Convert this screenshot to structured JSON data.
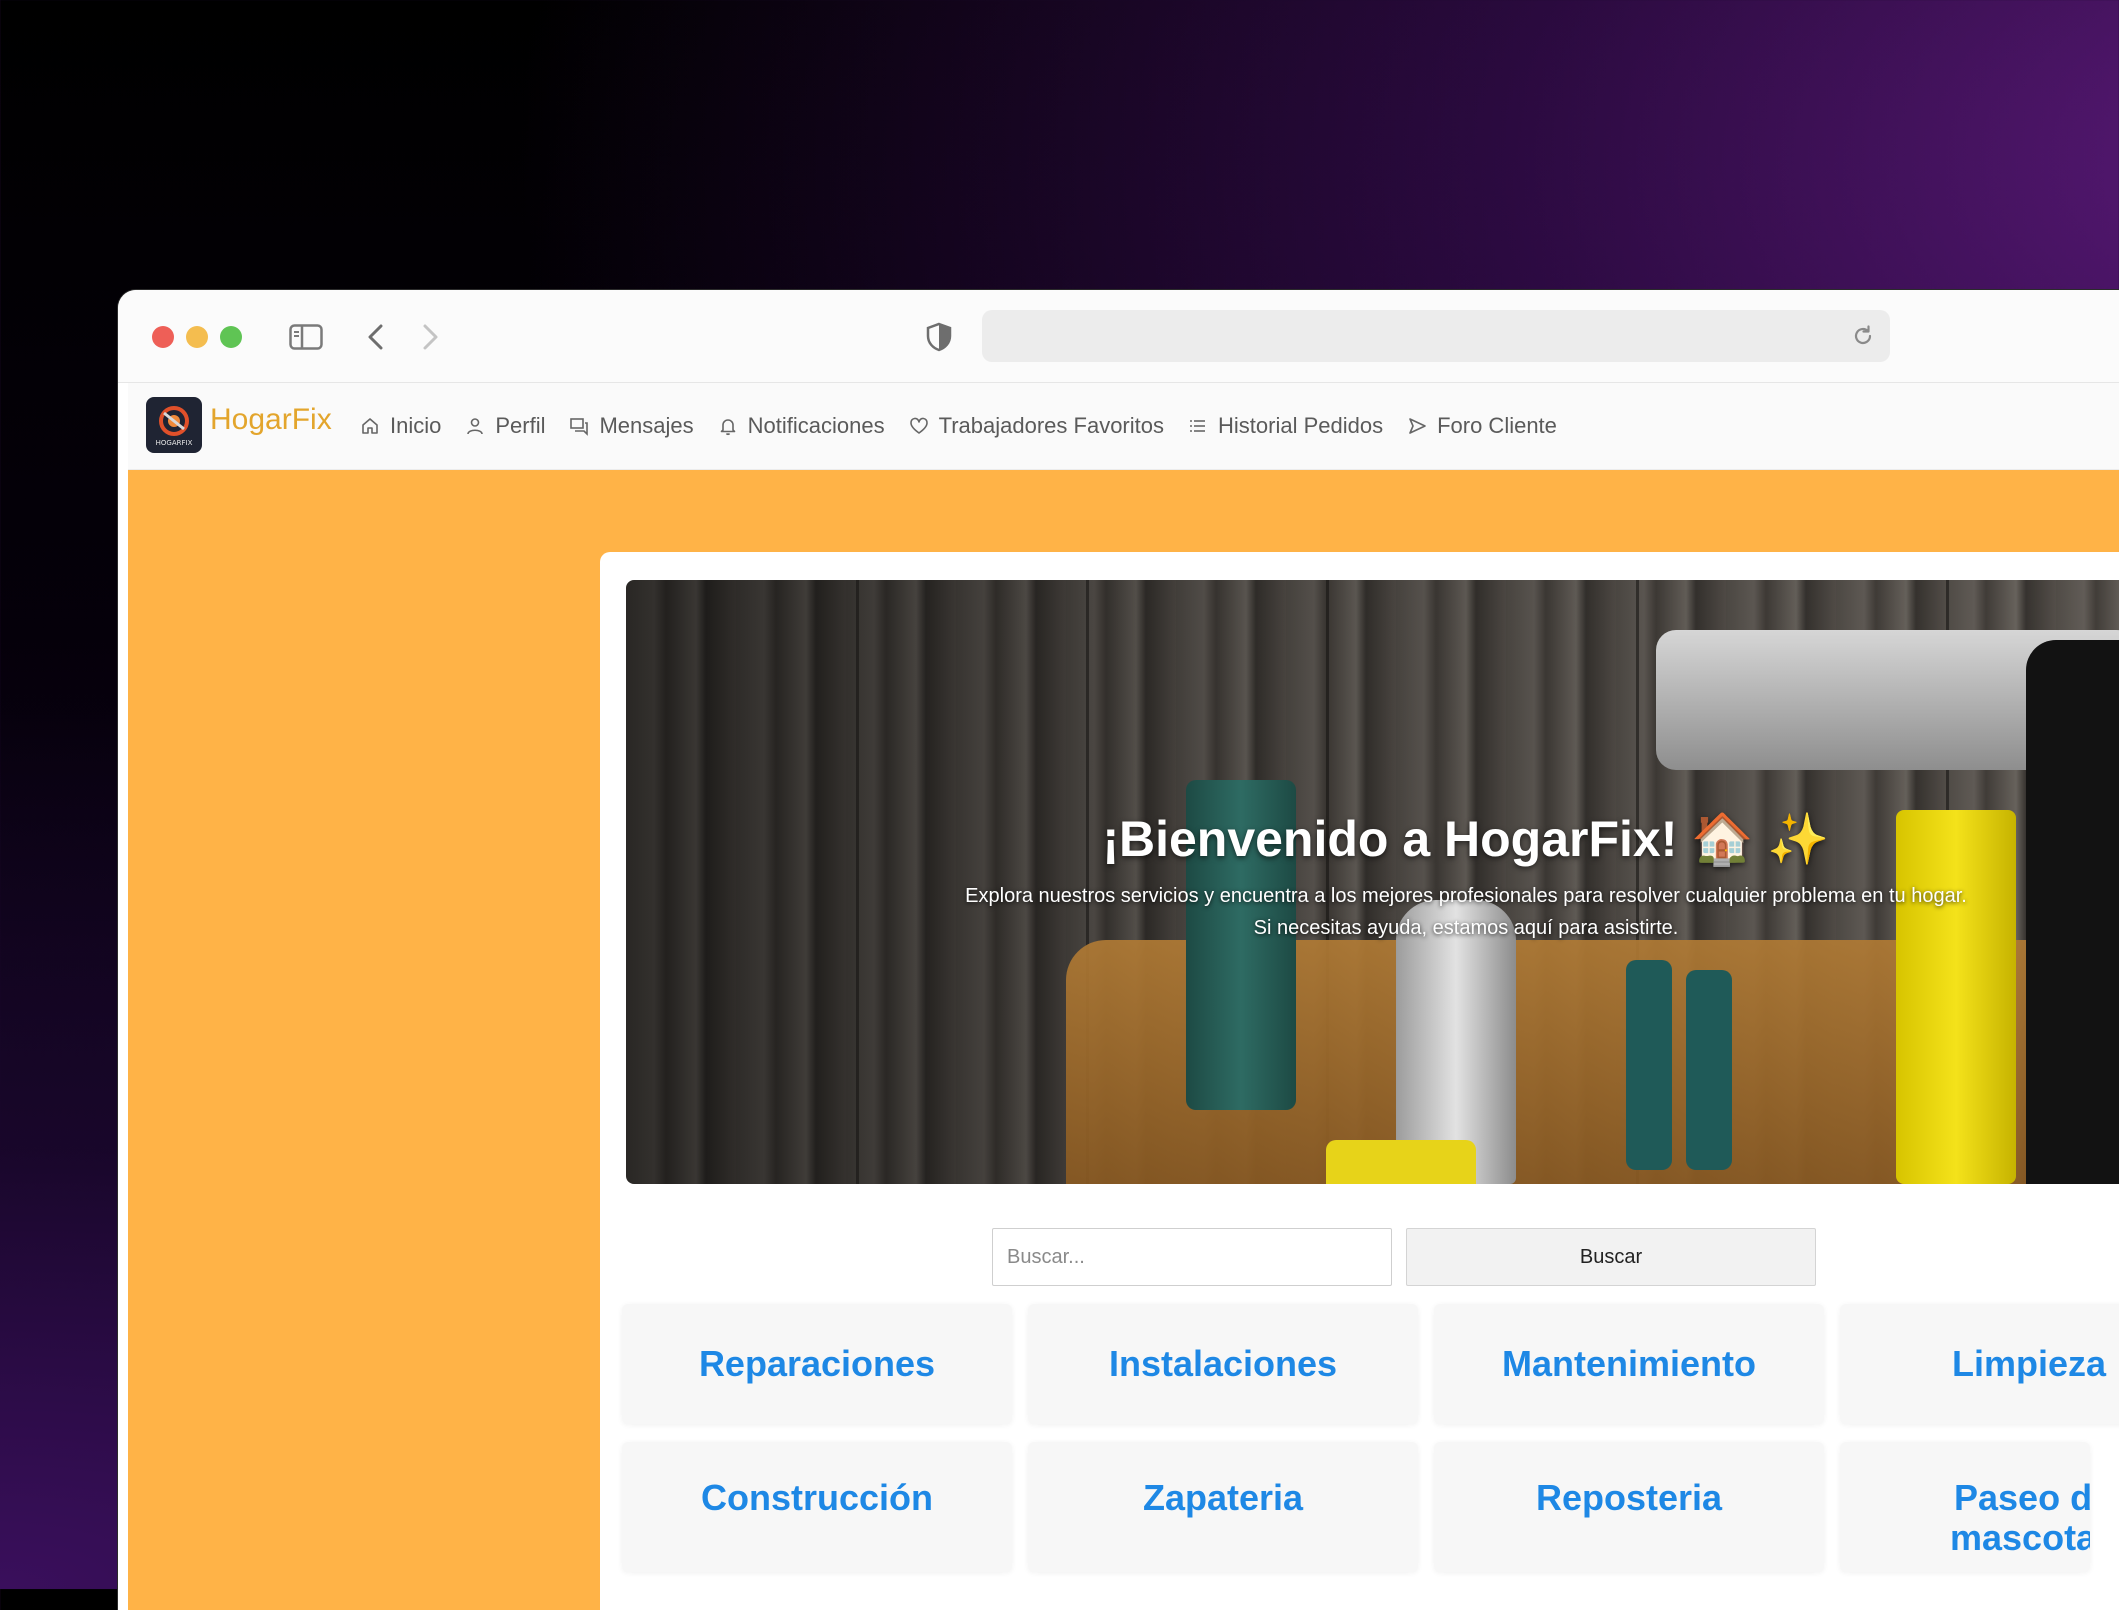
{
  "brand": {
    "name": "HogarFix",
    "logo_text": "HOGARFIX"
  },
  "nav": [
    {
      "label": "Inicio",
      "icon": "home-icon"
    },
    {
      "label": "Perfil",
      "icon": "user-icon"
    },
    {
      "label": "Mensajes",
      "icon": "chat-icon"
    },
    {
      "label": "Notificaciones",
      "icon": "bell-icon"
    },
    {
      "label": "Trabajadores Favoritos",
      "icon": "heart-icon"
    },
    {
      "label": "Historial Pedidos",
      "icon": "list-icon"
    },
    {
      "label": "Foro Cliente",
      "icon": "send-icon"
    }
  ],
  "hero": {
    "title": "¡Bienvenido a HogarFix! 🏠 ✨",
    "line1": "Explora nuestros servicios y encuentra a los mejores profesionales para resolver cualquier problema en tu hogar.",
    "line2": "Si necesitas ayuda, estamos aquí para asistirte."
  },
  "search": {
    "placeholder": "Buscar...",
    "button": "Buscar"
  },
  "categories": [
    "Reparaciones",
    "Instalaciones",
    "Mantenimiento",
    "Limpieza",
    "Construcción",
    "Zapateria",
    "Reposteria",
    "Paseo de mascotas"
  ],
  "colors": {
    "page_bg": "#ffb347",
    "brand": "#e3a52c",
    "category_text": "#1e88e5"
  }
}
